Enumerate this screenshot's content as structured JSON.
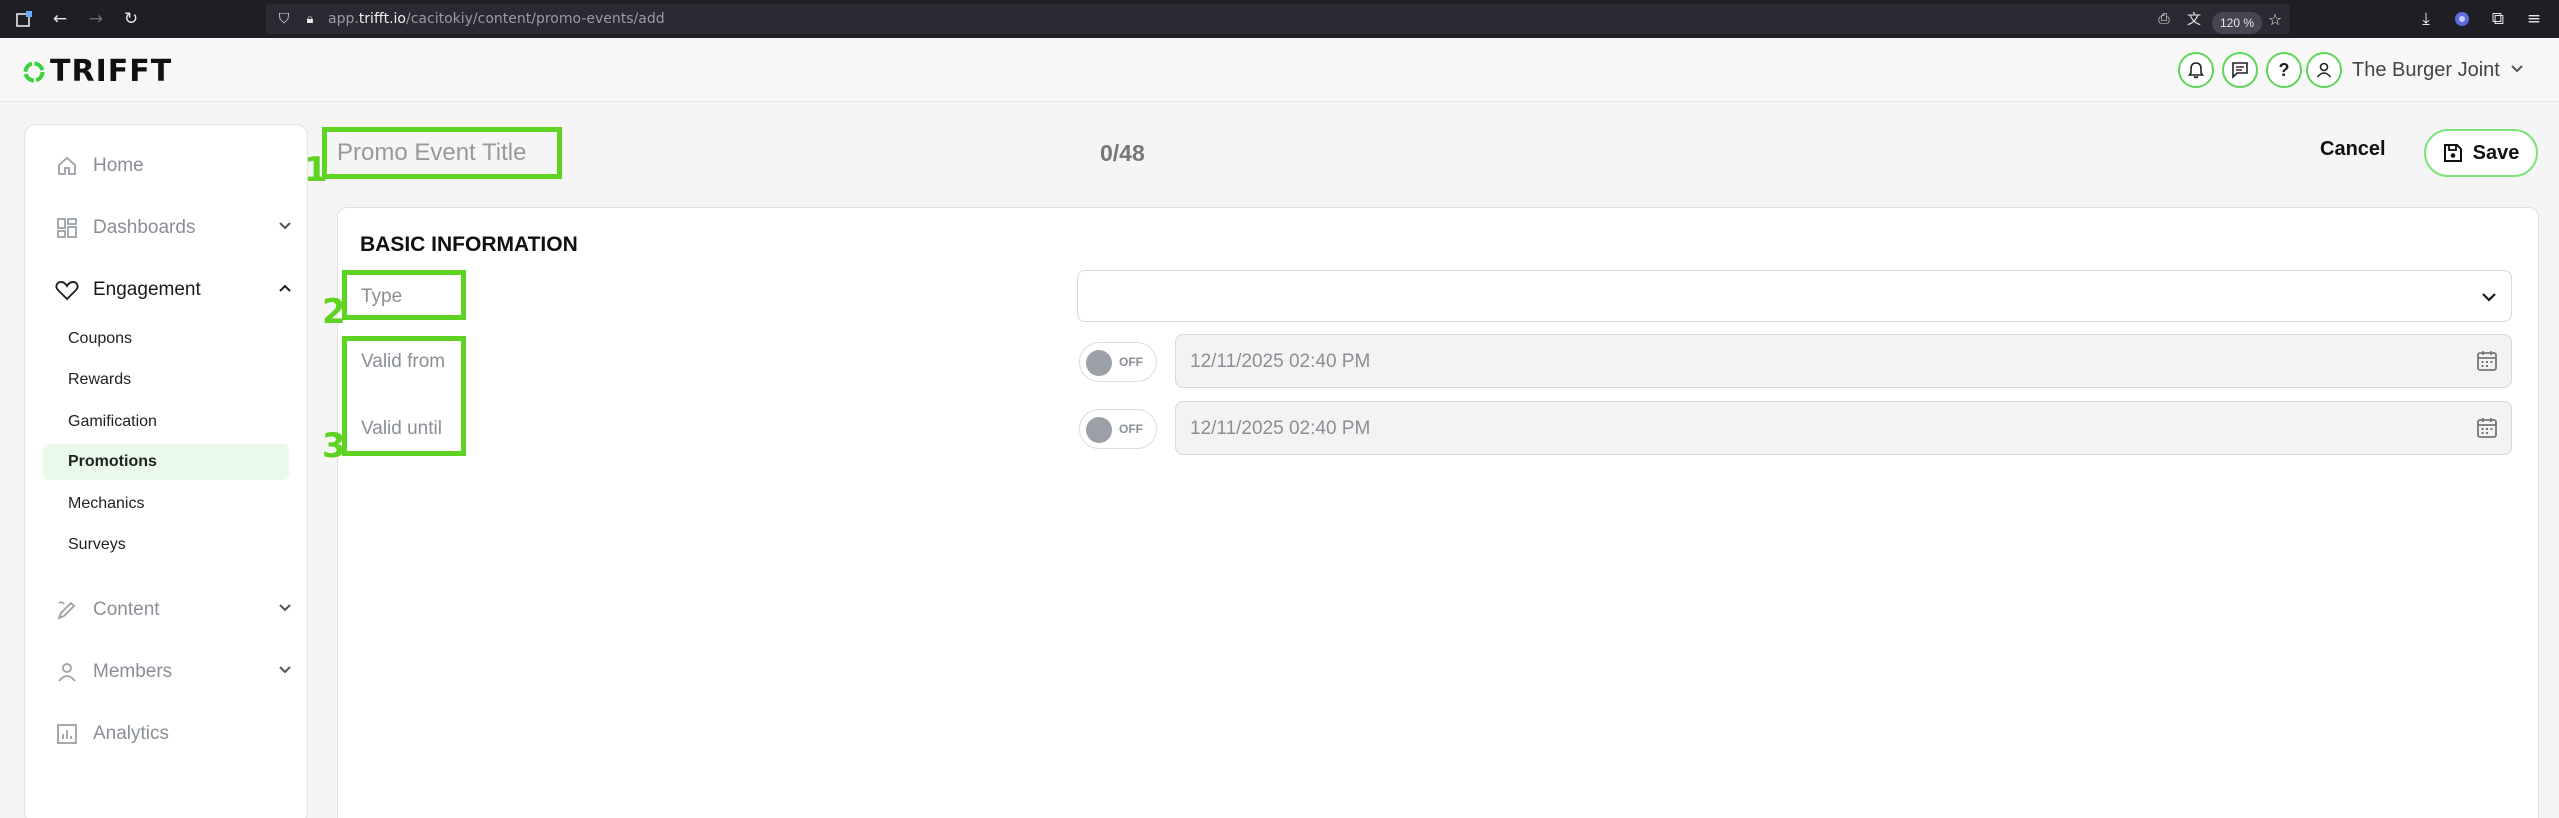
{
  "browser": {
    "url_prefix": "app.",
    "url_domain": "trifft.io",
    "url_path": "/cacitokiy/content/promo-events/add",
    "zoom": "120 %"
  },
  "header": {
    "logo_text": "TRIFFT",
    "org_name": "The Burger Joint",
    "help_label": "?"
  },
  "sidebar": {
    "items": [
      {
        "label": "Home"
      },
      {
        "label": "Dashboards"
      },
      {
        "label": "Engagement"
      },
      {
        "label": "Content"
      },
      {
        "label": "Members"
      },
      {
        "label": "Analytics"
      }
    ],
    "engagement_sub": [
      {
        "label": "Coupons"
      },
      {
        "label": "Rewards"
      },
      {
        "label": "Gamification"
      },
      {
        "label": "Promotions"
      },
      {
        "label": "Mechanics"
      },
      {
        "label": "Surveys"
      }
    ]
  },
  "main": {
    "title_placeholder": "Promo Event Title",
    "char_count": "0/48",
    "cancel_label": "Cancel",
    "save_label": "Save",
    "section_title": "BASIC INFORMATION",
    "type_label": "Type",
    "type_value": "",
    "valid_from_label": "Valid from",
    "valid_until_label": "Valid until",
    "toggle_off_label": "OFF",
    "valid_from_value": "12/11/2025 02:40 PM",
    "valid_until_value": "12/11/2025 02:40 PM"
  },
  "annotations": [
    "1",
    "2",
    "3"
  ],
  "colors": {
    "brand_green": "#5fd321",
    "active_bg": "#e9fbe8"
  }
}
